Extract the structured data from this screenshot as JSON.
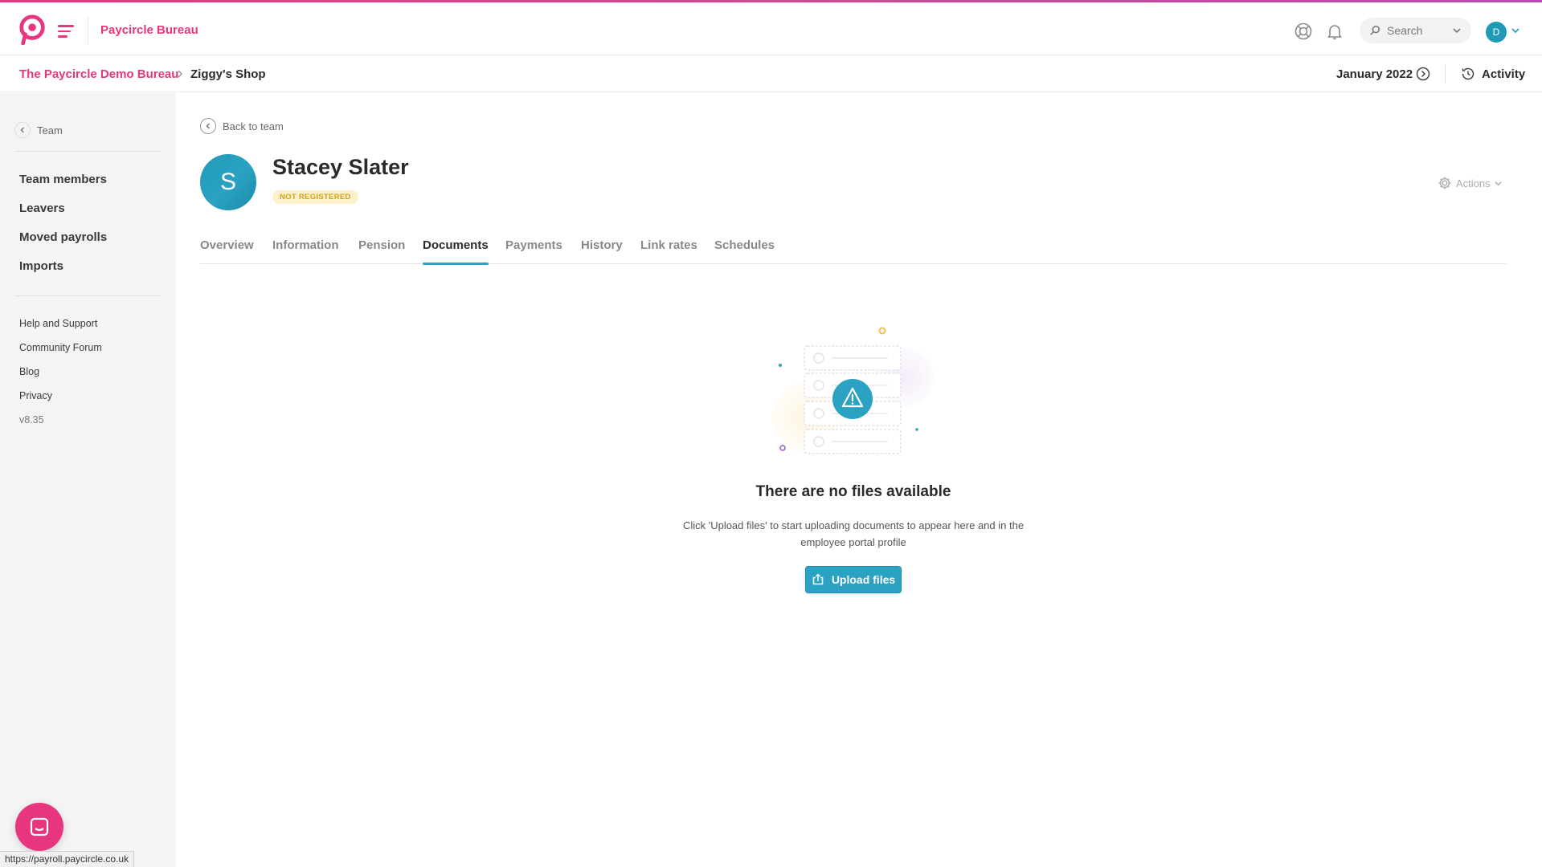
{
  "header": {
    "brand_name": "Paycircle Bureau",
    "search_placeholder": "Search",
    "user_initial": "D"
  },
  "breadcrumb": {
    "root": "The Paycircle Demo Bureau",
    "current": "Ziggy's Shop",
    "period": "January 2022",
    "activity_label": "Activity"
  },
  "sidebar": {
    "back_label": "Team",
    "main_items": [
      {
        "label": "Team members"
      },
      {
        "label": "Leavers"
      },
      {
        "label": "Moved payrolls"
      },
      {
        "label": "Imports"
      }
    ],
    "footer_items": [
      {
        "label": "Help and Support"
      },
      {
        "label": "Community Forum"
      },
      {
        "label": "Blog"
      },
      {
        "label": "Privacy"
      }
    ],
    "version": "v8.35"
  },
  "employee": {
    "back_label": "Back to team",
    "initial": "S",
    "name": "Stacey Slater",
    "status": "NOT REGISTERED",
    "actions_label": "Actions"
  },
  "tabs": [
    {
      "label": "Overview"
    },
    {
      "label": "Information"
    },
    {
      "label": "Pension"
    },
    {
      "label": "Documents",
      "active": true
    },
    {
      "label": "Payments"
    },
    {
      "label": "History"
    },
    {
      "label": "Link rates"
    },
    {
      "label": "Schedules"
    }
  ],
  "empty_state": {
    "title": "There are no files available",
    "text": "Click 'Upload files' to start uploading documents to appear here and in the employee portal profile",
    "button_label": "Upload files"
  },
  "status_bar_url": "https://payroll.paycircle.co.uk",
  "colors": {
    "brand_pink": "#e8357f",
    "accent_teal": "#2ba2c2",
    "badge_bg": "#fdf1cc",
    "badge_text": "#d3a21b",
    "sidebar_bg": "#f4f4f4"
  },
  "icons": [
    "paycircle-logo-icon",
    "menu-icon",
    "help-lifebuoy-icon",
    "bell-icon",
    "search-icon",
    "chevron-down-icon",
    "chevron-right-icon",
    "clock-arrow-icon",
    "history-icon",
    "chevron-left-icon",
    "gear-icon",
    "warning-icon",
    "upload-icon",
    "chat-icon"
  ]
}
